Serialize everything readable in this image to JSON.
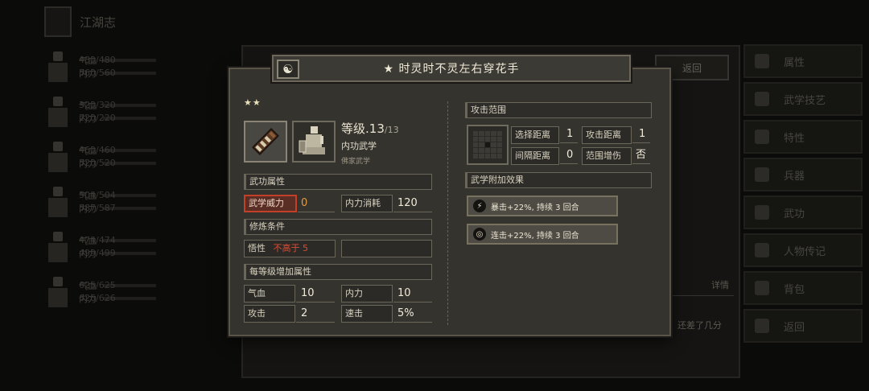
{
  "background": {
    "header_title": "江湖志",
    "characters": [
      {
        "hp_label": "气血",
        "hp_value": "480/480",
        "mp_label": "内力",
        "mp_value": "560/560"
      },
      {
        "hp_label": "气血",
        "hp_value": "320/320",
        "mp_label": "内力",
        "mp_value": "220/220"
      },
      {
        "hp_label": "气血",
        "hp_value": "460/460",
        "mp_label": "内力",
        "mp_value": "520/520"
      },
      {
        "hp_label": "气血",
        "hp_value": "504/504",
        "mp_label": "内力",
        "mp_value": "587/587"
      },
      {
        "hp_label": "气血",
        "hp_value": "474/474",
        "mp_label": "内力",
        "mp_value": "499/499"
      },
      {
        "hp_label": "气血",
        "hp_value": "625/625",
        "mp_label": "内力",
        "mp_value": "626/626"
      }
    ],
    "back_label": "返回",
    "details_label": "详情",
    "note_text": "还差了几分",
    "menu": [
      "属性",
      "武学技艺",
      "特性",
      "兵器",
      "武功",
      "人物传记",
      "背包",
      "返回"
    ]
  },
  "modal": {
    "title": "★ 时灵时不灵左右穿花手",
    "title_icon": "☯",
    "stars": "★★",
    "level_label": "等级.",
    "level_value": "13",
    "level_max": "/13",
    "type": "内功武学",
    "school": "佛家武学",
    "sections": {
      "attributes": "武功属性",
      "requirements": "修炼条件",
      "per_level": "每等级增加属性",
      "range": "攻击范围",
      "effects": "武学附加效果"
    },
    "power_label": "武学威力",
    "power_value": "0",
    "mp_cost_label": "内力消耗",
    "mp_cost_value": "120",
    "req_label": "悟性",
    "req_value": "不高于 5",
    "per_level_stats": [
      {
        "label": "气血",
        "value": "10"
      },
      {
        "label": "内力",
        "value": "10"
      },
      {
        "label": "攻击",
        "value": "2"
      },
      {
        "label": "速击",
        "value": "5%"
      }
    ],
    "range": {
      "select_label": "选择距离",
      "select_value": "1",
      "attack_label": "攻击距离",
      "attack_value": "1",
      "gap_label": "间隔距离",
      "gap_value": "0",
      "aoe_label": "范围增伤",
      "aoe_value": "否"
    },
    "effects": [
      {
        "icon": "⚡",
        "text": "暴击+22%, 持续 3 回合"
      },
      {
        "icon": "◎",
        "text": "连击+22%, 持续 3 回合"
      }
    ],
    "colors": {
      "highlight": "#c23f28",
      "power_value": "#e29a42",
      "requirement": "#e04a32"
    }
  }
}
